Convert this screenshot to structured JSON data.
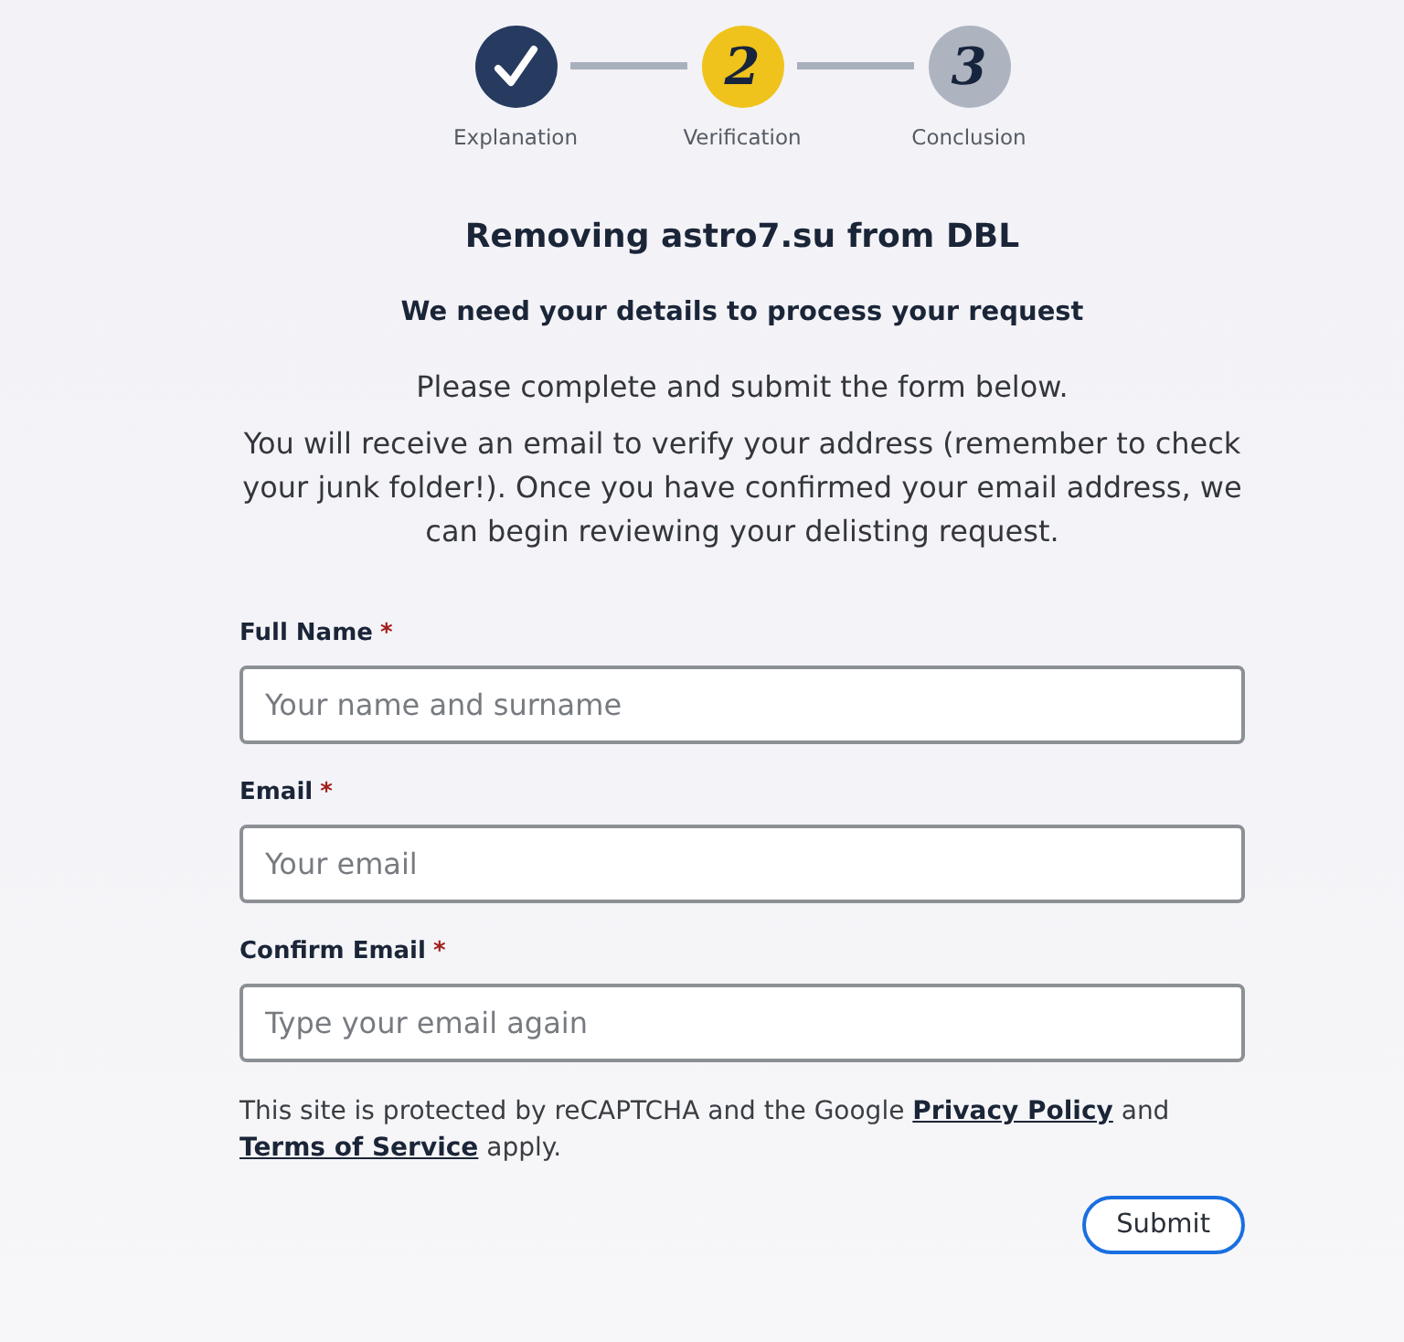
{
  "steps": [
    {
      "label": "Explanation",
      "completed": true,
      "selected": false
    },
    {
      "number": "2",
      "label": "Verification",
      "completed": false,
      "selected": true
    },
    {
      "number": "3",
      "label": "Conclusion",
      "completed": false,
      "selected": false
    }
  ],
  "title": "Removing astro7.su from DBL",
  "subtitle": "We need your details to process your request",
  "intro": [
    "Please complete and submit the form below.",
    "You will receive an email to verify your address (remember to check your junk folder!). Once you have confirmed your email address, we can begin reviewing your delisting request."
  ],
  "fields": [
    {
      "label": "Full Name",
      "required_mark": "*",
      "placeholder": "Your name and surname"
    },
    {
      "label": "Email",
      "required_mark": "*",
      "placeholder": "Your email"
    },
    {
      "label": "Confirm Email",
      "required_mark": "*",
      "placeholder": "Type your email again"
    }
  ],
  "notice": [
    {
      "kind": "text",
      "text": "This site is protected by reCAPTCHA and the Google"
    },
    {
      "kind": "link",
      "text": "Privacy Policy"
    },
    {
      "kind": "text",
      "text": "and"
    },
    {
      "kind": "link",
      "text": "Terms of Service"
    },
    {
      "kind": "text",
      "text": "apply."
    }
  ],
  "submit": {
    "label": "Submit"
  }
}
